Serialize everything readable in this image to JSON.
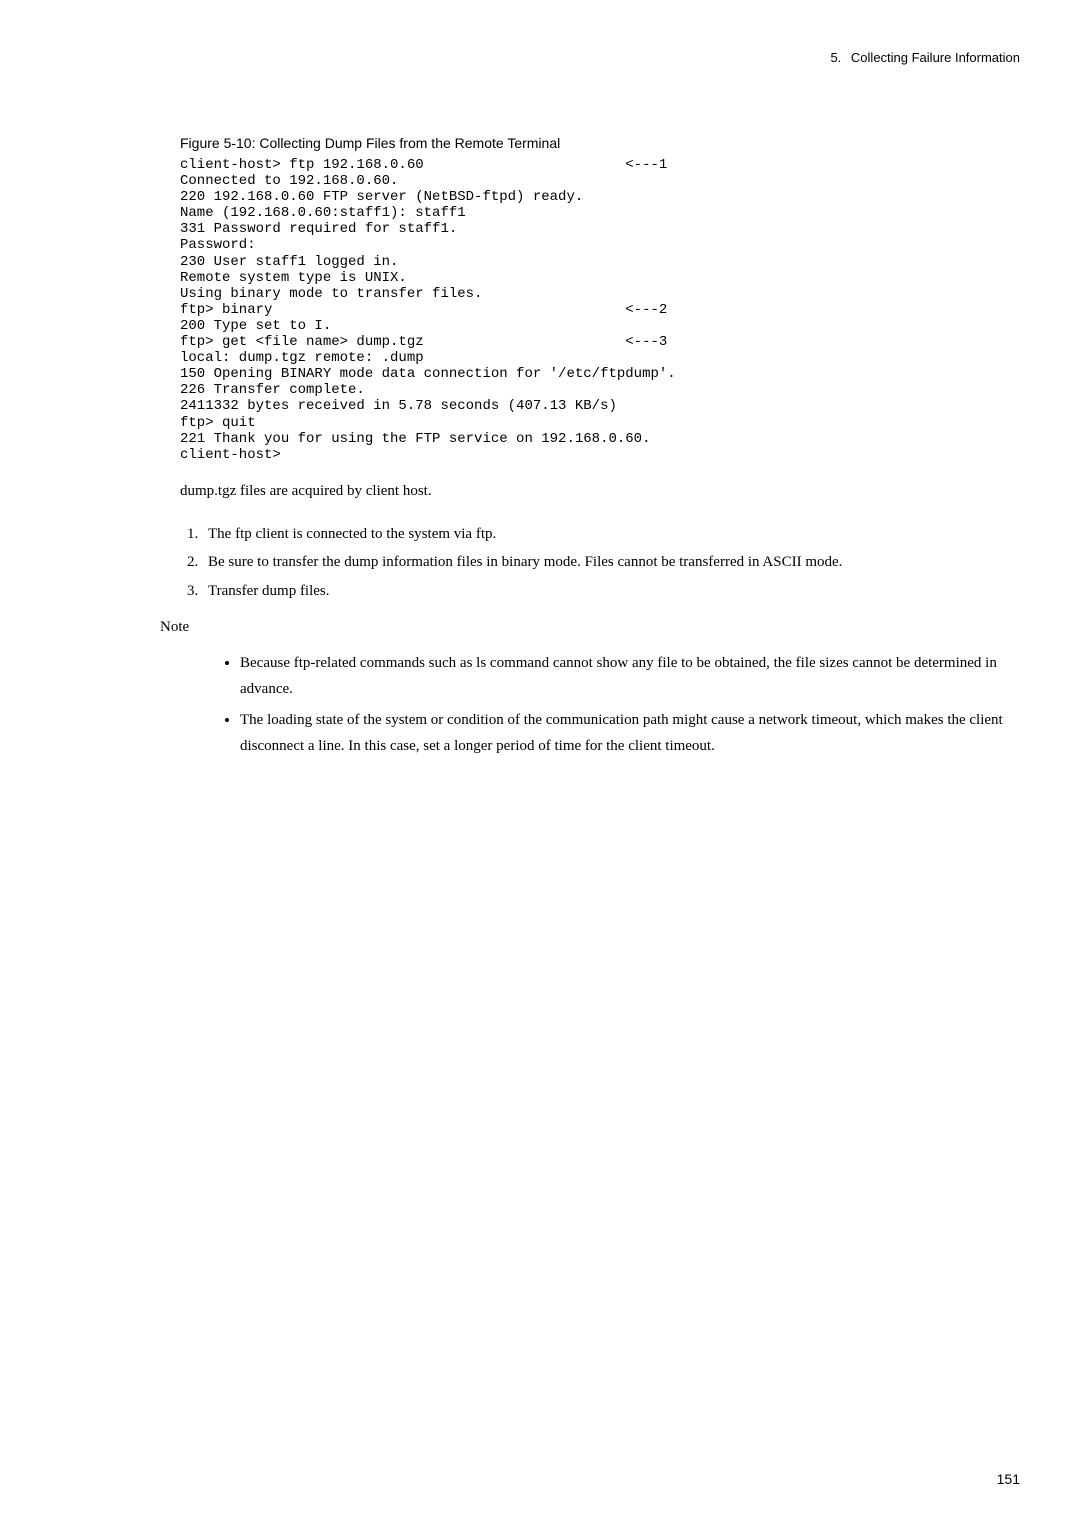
{
  "header": {
    "chapter_number": "5.",
    "chapter_title": "Collecting Failure Information"
  },
  "figure": {
    "caption": "Figure 5-10: Collecting Dump Files from the Remote Terminal",
    "code": "client-host> ftp 192.168.0.60                        <---1\nConnected to 192.168.0.60.\n220 192.168.0.60 FTP server (NetBSD-ftpd) ready.\nName (192.168.0.60:staff1): staff1\n331 Password required for staff1.\nPassword:\n230 User staff1 logged in.\nRemote system type is UNIX.\nUsing binary mode to transfer files.\nftp> binary                                          <---2\n200 Type set to I.\nftp> get <file name> dump.tgz                        <---3\nlocal: dump.tgz remote: .dump\n150 Opening BINARY mode data connection for '/etc/ftpdump'.\n226 Transfer complete.\n2411332 bytes received in 5.78 seconds (407.13 KB/s)\nftp> quit\n221 Thank you for using the FTP service on 192.168.0.60.\nclient-host>"
  },
  "acquired_line": "dump.tgz files are acquired by client host.",
  "steps": [
    "The ftp client is connected to the system via ftp.",
    "Be sure to transfer the dump information files in binary mode. Files cannot be transferred in ASCII mode.",
    "Transfer dump files."
  ],
  "note_label": "Note",
  "notes": [
    "Because ftp-related commands such as ls command cannot show any file to be obtained, the file sizes cannot be determined in advance.",
    "The loading state of the system or condition of the communication path might cause a network timeout, which makes the client disconnect a line. In this case, set a longer period of time for the client timeout."
  ],
  "page_number": "151"
}
